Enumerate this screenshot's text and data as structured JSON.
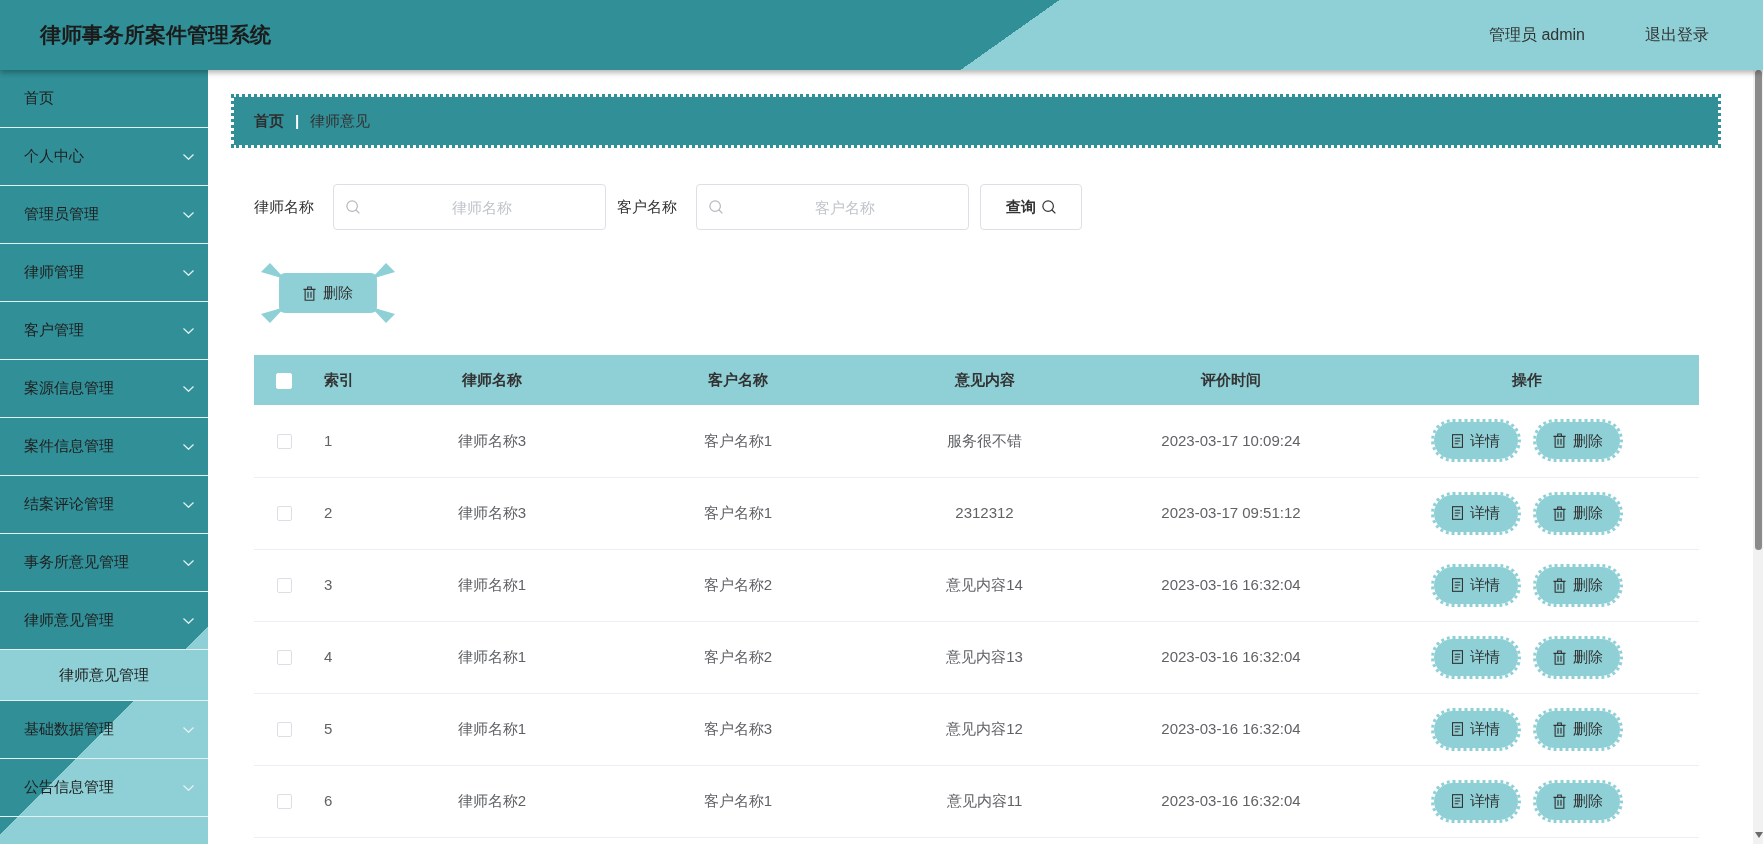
{
  "header": {
    "title": "律师事务所案件管理系统",
    "user": "管理员 admin",
    "logout": "退出登录"
  },
  "sidebar": {
    "items": [
      {
        "label": "首页",
        "kind": "link"
      },
      {
        "label": "个人中心",
        "kind": "menu"
      },
      {
        "label": "管理员管理",
        "kind": "menu"
      },
      {
        "label": "律师管理",
        "kind": "menu"
      },
      {
        "label": "客户管理",
        "kind": "menu"
      },
      {
        "label": "案源信息管理",
        "kind": "menu"
      },
      {
        "label": "案件信息管理",
        "kind": "menu"
      },
      {
        "label": "结案评论管理",
        "kind": "menu"
      },
      {
        "label": "事务所意见管理",
        "kind": "menu"
      },
      {
        "label": "律师意见管理",
        "kind": "menu",
        "children": [
          {
            "label": "律师意见管理",
            "selected": true
          }
        ]
      },
      {
        "label": "基础数据管理",
        "kind": "menu"
      },
      {
        "label": "公告信息管理",
        "kind": "menu"
      }
    ]
  },
  "breadcrumb": {
    "items": [
      "首页",
      "律师意见"
    ],
    "separator": "|"
  },
  "search": {
    "fields": [
      {
        "label": "律师名称",
        "placeholder": "律师名称"
      },
      {
        "label": "客户名称",
        "placeholder": "客户名称"
      }
    ],
    "button": "查询"
  },
  "toolbar": {
    "delete_button": "删除"
  },
  "table": {
    "select_all_checked": false,
    "columns": [
      "索引",
      "律师名称",
      "客户名称",
      "意见内容",
      "评价时间",
      "操作"
    ],
    "rows": [
      {
        "checked": false,
        "cells": [
          "1",
          "律师名称3",
          "客户名称1",
          "服务很不错",
          "2023-03-17 10:09:24"
        ],
        "actions": [
          {
            "kind": "detail",
            "label": "详情"
          },
          {
            "kind": "delete",
            "label": "删除"
          }
        ]
      },
      {
        "checked": false,
        "cells": [
          "2",
          "律师名称3",
          "客户名称1",
          "2312312",
          "2023-03-17 09:51:12"
        ],
        "actions": [
          {
            "kind": "detail",
            "label": "详情"
          },
          {
            "kind": "delete",
            "label": "删除"
          }
        ]
      },
      {
        "checked": false,
        "cells": [
          "3",
          "律师名称1",
          "客户名称2",
          "意见内容14",
          "2023-03-16 16:32:04"
        ],
        "actions": [
          {
            "kind": "detail",
            "label": "详情"
          },
          {
            "kind": "delete",
            "label": "删除"
          }
        ]
      },
      {
        "checked": false,
        "cells": [
          "4",
          "律师名称1",
          "客户名称2",
          "意见内容13",
          "2023-03-16 16:32:04"
        ],
        "actions": [
          {
            "kind": "detail",
            "label": "详情"
          },
          {
            "kind": "delete",
            "label": "删除"
          }
        ]
      },
      {
        "checked": false,
        "cells": [
          "5",
          "律师名称1",
          "客户名称3",
          "意见内容12",
          "2023-03-16 16:32:04"
        ],
        "actions": [
          {
            "kind": "detail",
            "label": "详情"
          },
          {
            "kind": "delete",
            "label": "删除"
          }
        ]
      },
      {
        "checked": false,
        "cells": [
          "6",
          "律师名称2",
          "客户名称1",
          "意见内容11",
          "2023-03-16 16:32:04"
        ],
        "actions": [
          {
            "kind": "detail",
            "label": "详情"
          },
          {
            "kind": "delete",
            "label": "删除"
          }
        ]
      }
    ]
  }
}
